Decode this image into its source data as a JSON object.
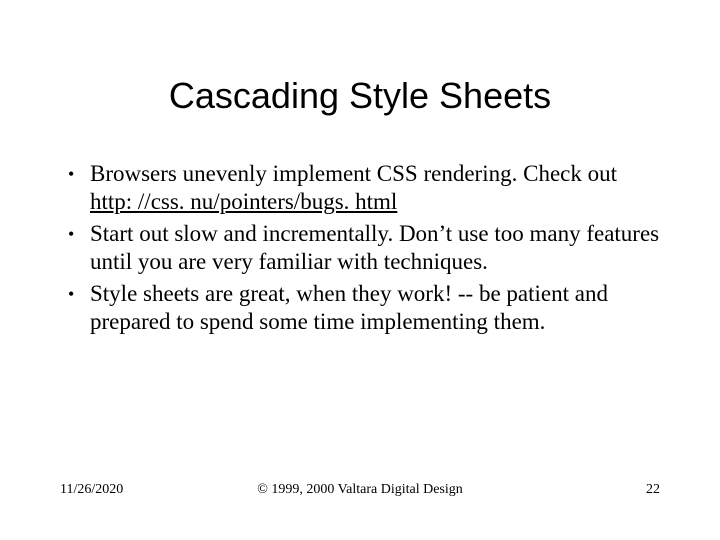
{
  "title": "Cascading Style Sheets",
  "bullets": [
    {
      "pre": "Browsers unevenly implement CSS rendering. Check out ",
      "link": "http: //css. nu/pointers/bugs. html",
      "post": ""
    },
    {
      "pre": "Start out slow and incrementally. Don’t use too many features until you are very familiar with techniques.",
      "link": "",
      "post": ""
    },
    {
      "pre": "Style sheets are great, when they work! -- be patient and prepared to spend some time implementing them.",
      "link": "",
      "post": ""
    }
  ],
  "footer": {
    "date": "11/26/2020",
    "copyright": "© 1999, 2000 Valtara Digital Design",
    "page": "22"
  }
}
